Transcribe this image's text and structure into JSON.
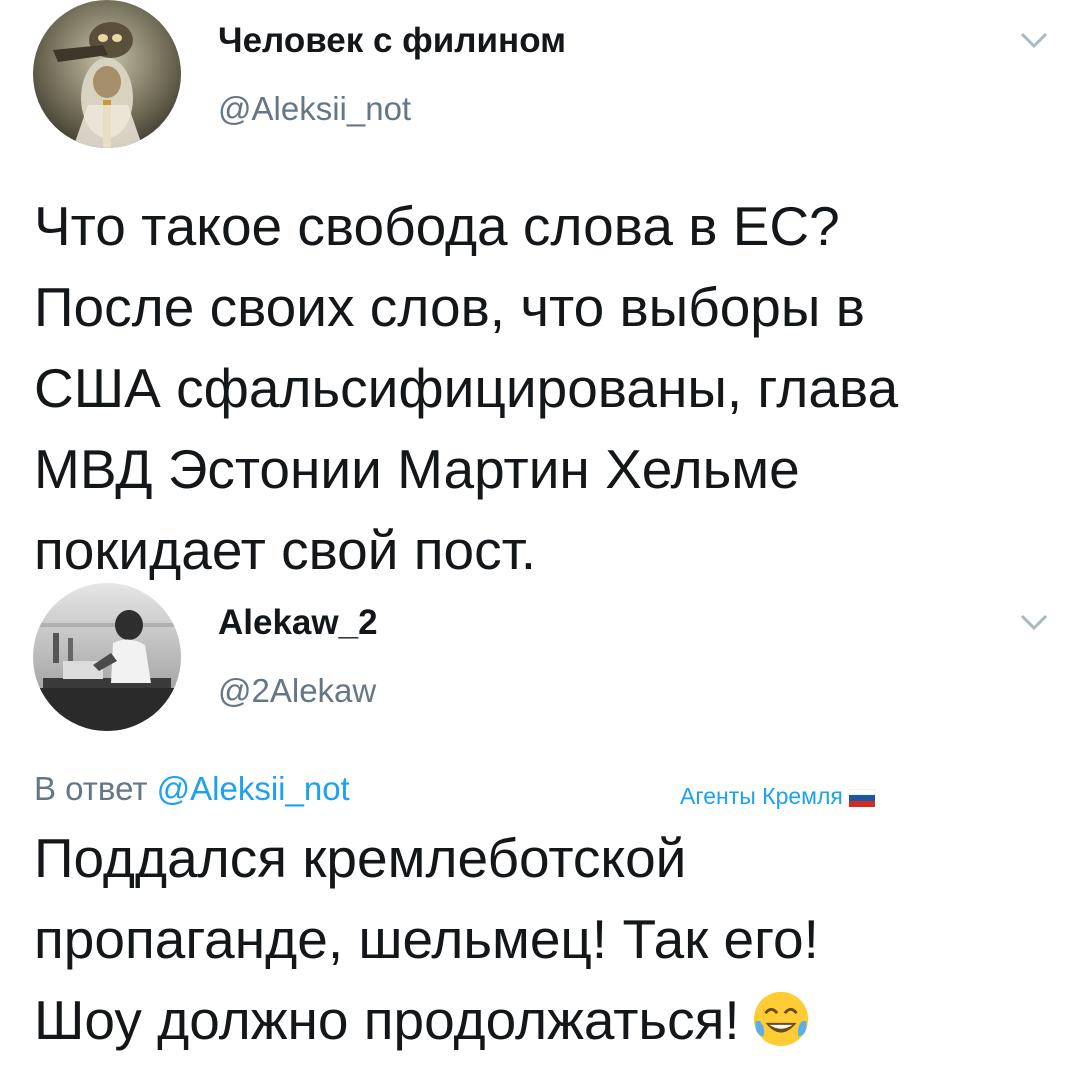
{
  "tweets": [
    {
      "display_name": "Человек с филином",
      "handle": "@Aleksii_not",
      "avatar_icon": "owl-portrait-avatar",
      "menu_icon": "chevron-down-icon",
      "text_lines": [
        "Что такое свобода слова в ЕС?",
        "После своих слов, что выборы в",
        "США сфальсифицированы, глава",
        "МВД Эстонии Мартин Хельме",
        "покидает свой пост."
      ]
    },
    {
      "display_name": "Alekaw_2",
      "handle": "@2Alekaw",
      "avatar_icon": "reading-man-avatar",
      "menu_icon": "chevron-down-icon",
      "reply_prefix": "В ответ",
      "reply_mention": "@Aleksii_not",
      "list_tag": "Агенты Кремля",
      "list_tag_icon": "russian-flag-icon",
      "text_lines": [
        "Поддался кремлеботской",
        "пропаганде, шельмец! Так его!",
        "Шоу должно продолжаться!"
      ],
      "emoji_icon": "face-with-tears-of-joy-icon"
    }
  ],
  "colors": {
    "text": "#14171a",
    "secondary": "#657786",
    "link": "#1da1f2",
    "background": "#ffffff"
  }
}
